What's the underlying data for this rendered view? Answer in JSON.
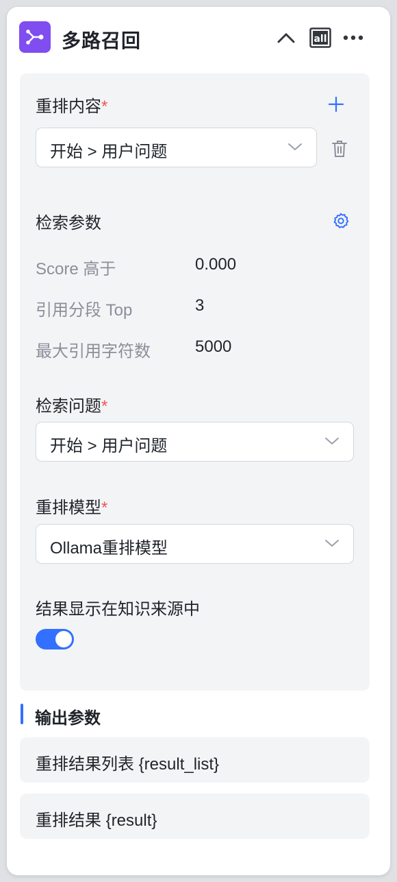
{
  "node": {
    "title": "多路召回"
  },
  "header": {
    "all_label": "all"
  },
  "rerank_content": {
    "label": "重排内容",
    "required_mark": "*",
    "selected": "开始 > 用户问题"
  },
  "retrieval_params": {
    "label": "检索参数",
    "items": [
      {
        "key": "Score 高于",
        "value": "0.000"
      },
      {
        "key": "引用分段 Top",
        "value": "3"
      },
      {
        "key": "最大引用字符数",
        "value": "5000"
      }
    ]
  },
  "search_question": {
    "label": "检索问题",
    "required_mark": "*",
    "selected": "开始 > 用户问题"
  },
  "rerank_model": {
    "label": "重排模型",
    "required_mark": "*",
    "selected": "Ollama重排模型"
  },
  "show_in_source": {
    "label": "结果显示在知识来源中",
    "enabled": true
  },
  "output": {
    "title": "输出参数",
    "items": [
      {
        "label": "重排结果列表 {result_list}"
      },
      {
        "label": "重排结果 {result}"
      }
    ]
  },
  "colors": {
    "accent": "#3370ff",
    "node_icon_bg": "#7f4df0",
    "required": "#f05555"
  }
}
